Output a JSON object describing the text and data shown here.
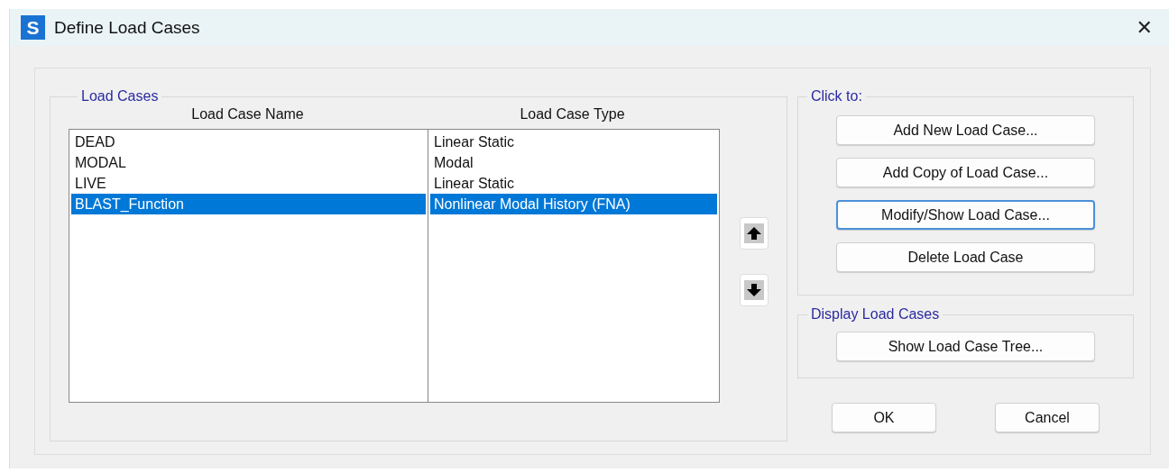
{
  "window": {
    "title": "Define Load Cases",
    "icon_letter": "S",
    "close": "✕"
  },
  "load_cases": {
    "title": "Load Cases",
    "columns": [
      "Load Case Name",
      "Load Case Type"
    ],
    "rows": [
      {
        "name": "DEAD",
        "type": "Linear Static",
        "selected": false
      },
      {
        "name": "MODAL",
        "type": "Modal",
        "selected": false
      },
      {
        "name": "LIVE",
        "type": "Linear Static",
        "selected": false
      },
      {
        "name": "BLAST_Function",
        "type": "Nonlinear Modal History (FNA)",
        "selected": true
      }
    ]
  },
  "move_buttons": [
    {
      "kind": "up"
    },
    {
      "kind": "down"
    }
  ],
  "click_to": {
    "title": "Click to:",
    "buttons": [
      {
        "label": "Add New Load Case...",
        "focused": false
      },
      {
        "label": "Add Copy of Load Case...",
        "focused": false
      },
      {
        "label": "Modify/Show Load Case...",
        "focused": true
      },
      {
        "label": "Delete Load Case",
        "focused": false
      }
    ]
  },
  "display": {
    "title": "Display Load Cases",
    "buttons": [
      {
        "label": "Show Load Case Tree...",
        "focused": false
      }
    ]
  },
  "footer_buttons": [
    {
      "label": "OK"
    },
    {
      "label": "Cancel"
    }
  ]
}
